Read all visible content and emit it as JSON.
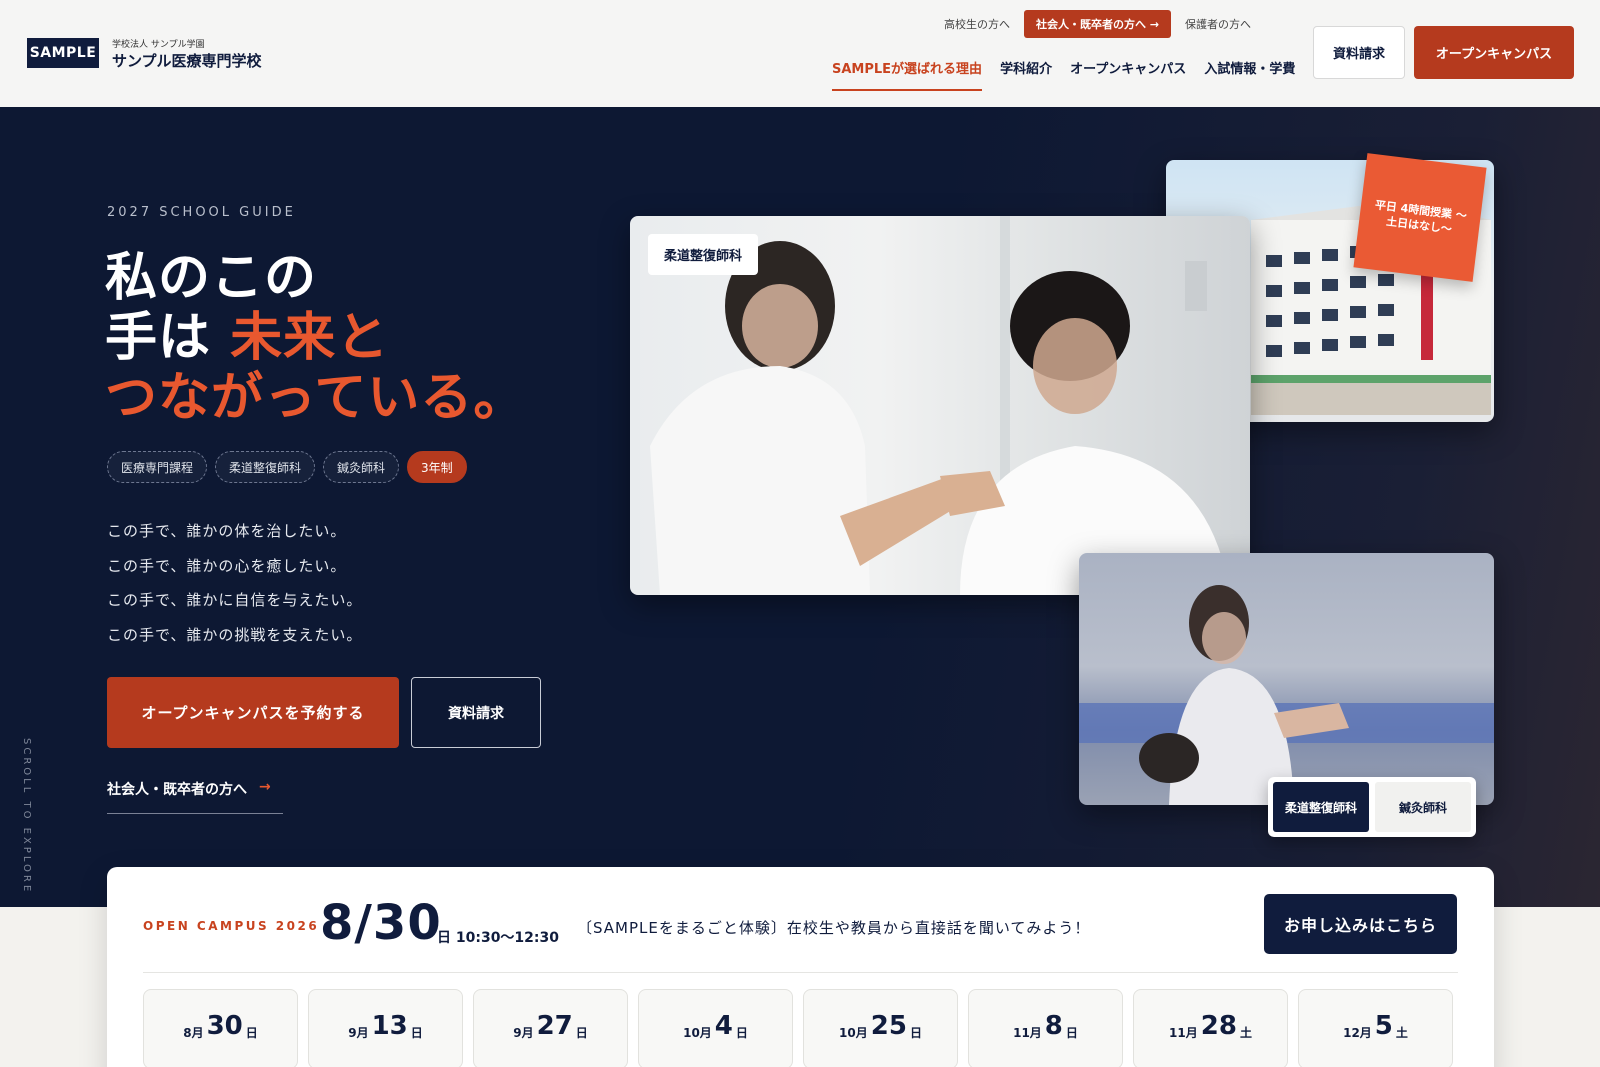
{
  "header": {
    "logo": "SAMPLE",
    "corp": "学校法人 サンプル学園",
    "school": "サンプル医療専門学校",
    "audience": [
      {
        "label": "高校生の方へ",
        "active": false
      },
      {
        "label": "社会人・既卒者の方へ →",
        "active": true
      },
      {
        "label": "保護者の方へ",
        "active": false
      }
    ],
    "nav": [
      {
        "label": "SAMPLEが選ばれる理由",
        "active": true
      },
      {
        "label": "学科紹介",
        "active": false
      },
      {
        "label": "オープンキャンパス",
        "active": false
      },
      {
        "label": "入試情報・学費",
        "active": false
      }
    ],
    "btn_request": "資料請求",
    "btn_open_campus": "オープンキャンパス"
  },
  "hero": {
    "eyebrow": "2027 SCHOOL GUIDE",
    "headline_1": "私のこの",
    "headline_2a": "手は",
    "headline_2b": "未来と",
    "headline_3": "つながっている。",
    "tags": [
      "医療専門課程",
      "柔道整復師科",
      "鍼灸師科",
      "3年制"
    ],
    "lines": [
      "この手で、誰かの体を治したい。",
      "この手で、誰かの心を癒したい。",
      "この手で、誰かに自信を与えたい。",
      "この手で、誰かの挑戦を支えたい。"
    ],
    "btn_reserve": "オープンキャンパスを予約する",
    "btn_request": "資料請求",
    "adult_link": "社会人・既卒者の方へ",
    "adult_arrow": "→",
    "scroll": "SCROLL TO EXPLORE",
    "photo_label": "柔道整復師科",
    "sticker": "平日 4時間授業 〜土日はなし〜",
    "toggle": [
      "柔道整復師科",
      "鍼灸師科"
    ]
  },
  "open_campus": {
    "eyebrow": "OPEN CAMPUS 2026",
    "date": "8/30",
    "time": "日 10:30〜12:30",
    "desc": "〔SAMPLEをまるごと体験〕在校生や教員から直接話を聞いてみよう！",
    "apply": "お申し込みはこちら",
    "dates": [
      {
        "m": "8月",
        "d": "30",
        "w": "日"
      },
      {
        "m": "9月",
        "d": "13",
        "w": "日"
      },
      {
        "m": "9月",
        "d": "27",
        "w": "日"
      },
      {
        "m": "10月",
        "d": "4",
        "w": "日"
      },
      {
        "m": "10月",
        "d": "25",
        "w": "日"
      },
      {
        "m": "11月",
        "d": "8",
        "w": "日"
      },
      {
        "m": "11月",
        "d": "28",
        "w": "土"
      },
      {
        "m": "12月",
        "d": "5",
        "w": "土"
      }
    ]
  },
  "colors": {
    "navy": "#0d1833",
    "accent": "#b53a1e",
    "accent_light": "#e8582f"
  }
}
